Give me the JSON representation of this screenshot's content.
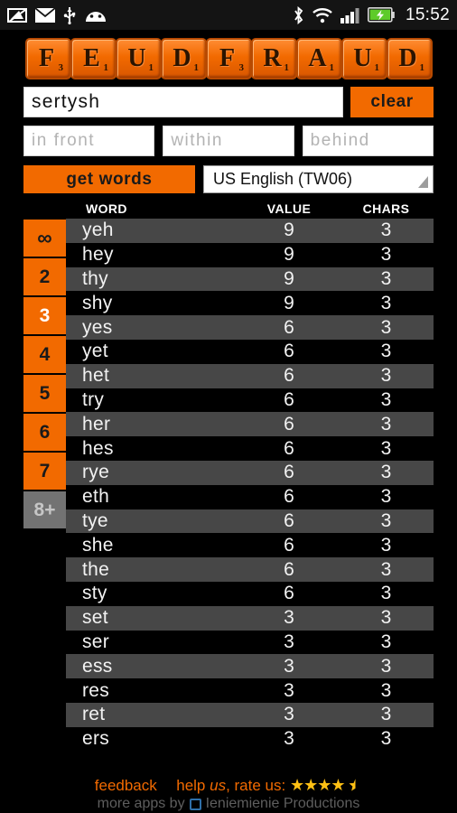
{
  "statusbar": {
    "icons_left": [
      "image-icon",
      "envelope-icon",
      "usb-icon",
      "android-head-icon"
    ],
    "icons_right": [
      "bluetooth-icon",
      "wifi-icon",
      "signal-icon",
      "battery-charging-icon"
    ],
    "time": "15:52"
  },
  "logo": {
    "tiles": [
      {
        "letter": "F",
        "points": "3"
      },
      {
        "letter": "E",
        "points": "1"
      },
      {
        "letter": "U",
        "points": "1"
      },
      {
        "letter": "D",
        "points": "1"
      },
      {
        "letter": "F",
        "points": "3"
      },
      {
        "letter": "R",
        "points": "1"
      },
      {
        "letter": "A",
        "points": "1"
      },
      {
        "letter": "U",
        "points": "1"
      },
      {
        "letter": "D",
        "points": "1"
      }
    ],
    "text": "FEUDFRAUD"
  },
  "form": {
    "word_value": "sertysh",
    "word_placeholder": "",
    "clear_label": "clear",
    "in_front_value": "",
    "in_front_placeholder": "in front",
    "within_value": "",
    "within_placeholder": "within",
    "behind_value": "",
    "behind_placeholder": "behind",
    "get_words_label": "get words",
    "dictionary_selected": "US English (TW06)"
  },
  "table": {
    "headers": {
      "word": "WORD",
      "value": "VALUE",
      "chars": "CHARS"
    },
    "filters": [
      {
        "label": "∞",
        "state": "normal"
      },
      {
        "label": "2",
        "state": "normal"
      },
      {
        "label": "3",
        "state": "active"
      },
      {
        "label": "4",
        "state": "normal"
      },
      {
        "label": "5",
        "state": "normal"
      },
      {
        "label": "6",
        "state": "normal"
      },
      {
        "label": "7",
        "state": "normal"
      },
      {
        "label": "8+",
        "state": "disabled"
      }
    ],
    "rows": [
      {
        "word": "yeh",
        "value": "9",
        "chars": "3"
      },
      {
        "word": "hey",
        "value": "9",
        "chars": "3"
      },
      {
        "word": "thy",
        "value": "9",
        "chars": "3"
      },
      {
        "word": "shy",
        "value": "9",
        "chars": "3"
      },
      {
        "word": "yes",
        "value": "6",
        "chars": "3"
      },
      {
        "word": "yet",
        "value": "6",
        "chars": "3"
      },
      {
        "word": "het",
        "value": "6",
        "chars": "3"
      },
      {
        "word": "try",
        "value": "6",
        "chars": "3"
      },
      {
        "word": "her",
        "value": "6",
        "chars": "3"
      },
      {
        "word": "hes",
        "value": "6",
        "chars": "3"
      },
      {
        "word": "rye",
        "value": "6",
        "chars": "3"
      },
      {
        "word": "eth",
        "value": "6",
        "chars": "3"
      },
      {
        "word": "tye",
        "value": "6",
        "chars": "3"
      },
      {
        "word": "she",
        "value": "6",
        "chars": "3"
      },
      {
        "word": "the",
        "value": "6",
        "chars": "3"
      },
      {
        "word": "sty",
        "value": "6",
        "chars": "3"
      },
      {
        "word": "set",
        "value": "3",
        "chars": "3"
      },
      {
        "word": "ser",
        "value": "3",
        "chars": "3"
      },
      {
        "word": "ess",
        "value": "3",
        "chars": "3"
      },
      {
        "word": "res",
        "value": "3",
        "chars": "3"
      },
      {
        "word": "ret",
        "value": "3",
        "chars": "3"
      },
      {
        "word": "ers",
        "value": "3",
        "chars": "3"
      }
    ]
  },
  "footer": {
    "feedback_label": "feedback",
    "help_label": "help",
    "help_us_label": "us",
    "rate_label": ", rate us:",
    "stars": "★★★★",
    "half_star": "★",
    "rating": "4.5",
    "more_apps_label": "more apps by",
    "brand": "Ieniemienie Productions"
  },
  "colors": {
    "accent": "#f26a00",
    "row_alt": "#474747",
    "background": "#000000",
    "star": "#ffc014",
    "disabled": "#737373"
  }
}
